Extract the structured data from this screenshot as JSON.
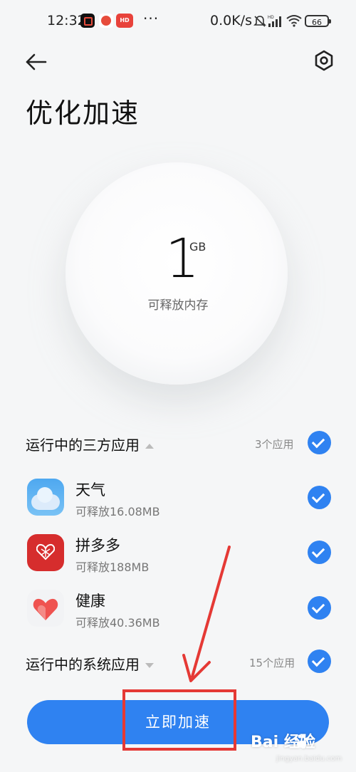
{
  "status_bar": {
    "time": "12:32",
    "speed": "0.0K/s",
    "battery": "66",
    "notif_icon_label": "HD",
    "app_badge": "HD"
  },
  "header": {
    "title": "优化加速"
  },
  "memory": {
    "value": "1",
    "unit": "GB",
    "caption": "可释放内存"
  },
  "third_party": {
    "label": "运行中的三方应用",
    "count": "3个应用",
    "apps": [
      {
        "name": "天气",
        "sub": "可释放16.08MB",
        "icon": "weather-icon"
      },
      {
        "name": "拼多多",
        "sub": "可释放188MB",
        "icon": "pinduoduo-icon"
      },
      {
        "name": "健康",
        "sub": "可释放40.36MB",
        "icon": "health-icon"
      }
    ]
  },
  "system": {
    "label": "运行中的系统应用",
    "count": "15个应用"
  },
  "action": {
    "label": "立即加速"
  },
  "watermark": {
    "text": "Bai 经验",
    "sub": "jingyan.baidu.com"
  },
  "colors": {
    "accent": "#2f82f1",
    "annotation": "#e53935"
  }
}
